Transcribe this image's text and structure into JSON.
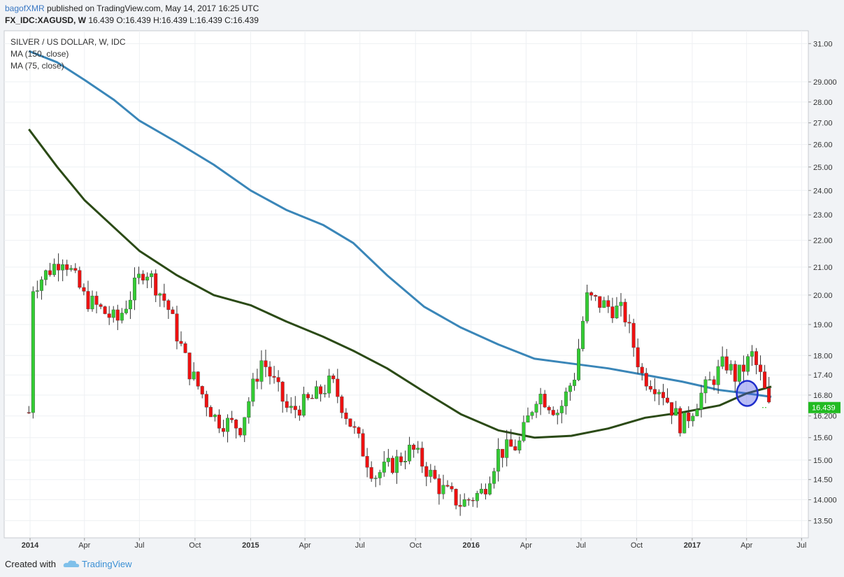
{
  "header": {
    "author": "bagofXMR",
    "published": "published on TradingView.com, May 14, 2017 16:25 UTC",
    "symbol": "FX_IDC:XAGUSD, W",
    "ohlc": "16.439 O:16.439 H:16.439 L:16.439 C:16.439"
  },
  "footer": {
    "created_with": "Created with",
    "brand": "TradingView"
  },
  "colors": {
    "up": "#33cc33",
    "down": "#ee1111",
    "ma150": "#3a86b8",
    "ma75": "#2b4a16",
    "marker": "#1f2ecc",
    "price_label": "#22bb22"
  },
  "chart_data": {
    "type": "candlestick",
    "title": "SILVER / US DOLLAR, W, IDC",
    "series": [
      {
        "name": "MA (150, close)"
      },
      {
        "name": "MA (75, close)"
      }
    ],
    "y_scale": "log",
    "ylim": [
      13.1,
      31.7
    ],
    "y_ticks": [
      "31.00",
      "29.000",
      "28.00",
      "27.00",
      "26.00",
      "25.00",
      "24.00",
      "23.00",
      "22.00",
      "21.00",
      "20.00",
      "19.00",
      "18.00",
      "17.40",
      "16.80",
      "16.200",
      "15.60",
      "15.00",
      "14.50",
      "14.000",
      "13.50"
    ],
    "x_ticks": [
      "2014",
      "Apr",
      "Jul",
      "Oct",
      "2015",
      "Apr",
      "Jul",
      "Oct",
      "2016",
      "Apr",
      "Jul",
      "Oct",
      "2017",
      "Apr",
      "Jul"
    ],
    "last_price_label": "16.439",
    "ma150_points": [
      [
        "2013-12-30",
        30.6
      ],
      [
        "2014-02-15",
        30.0
      ],
      [
        "2014-04-01",
        29.1
      ],
      [
        "2014-05-20",
        28.1
      ],
      [
        "2014-07-01",
        27.1
      ],
      [
        "2014-09-01",
        26.1
      ],
      [
        "2014-11-01",
        25.1
      ],
      [
        "2015-01-01",
        24.0
      ],
      [
        "2015-03-01",
        23.2
      ],
      [
        "2015-05-01",
        22.6
      ],
      [
        "2015-06-20",
        21.9
      ],
      [
        "2015-08-15",
        20.7
      ],
      [
        "2015-10-15",
        19.6
      ],
      [
        "2015-12-15",
        18.9
      ],
      [
        "2016-02-15",
        18.35
      ],
      [
        "2016-04-15",
        17.9
      ],
      [
        "2016-06-15",
        17.75
      ],
      [
        "2016-08-15",
        17.6
      ],
      [
        "2016-10-15",
        17.4
      ],
      [
        "2016-12-15",
        17.2
      ],
      [
        "2017-02-15",
        16.95
      ],
      [
        "2017-04-01",
        16.85
      ],
      [
        "2017-05-12",
        16.75
      ]
    ],
    "ma75_points": [
      [
        "2013-12-30",
        26.7
      ],
      [
        "2014-02-15",
        25.0
      ],
      [
        "2014-04-01",
        23.6
      ],
      [
        "2014-05-20",
        22.5
      ],
      [
        "2014-07-01",
        21.6
      ],
      [
        "2014-09-01",
        20.7
      ],
      [
        "2014-11-01",
        20.0
      ],
      [
        "2015-01-01",
        19.65
      ],
      [
        "2015-03-01",
        19.1
      ],
      [
        "2015-05-01",
        18.6
      ],
      [
        "2015-06-20",
        18.15
      ],
      [
        "2015-08-15",
        17.6
      ],
      [
        "2015-10-15",
        16.9
      ],
      [
        "2015-12-15",
        16.25
      ],
      [
        "2016-02-15",
        15.8
      ],
      [
        "2016-04-15",
        15.6
      ],
      [
        "2016-06-15",
        15.65
      ],
      [
        "2016-08-15",
        15.85
      ],
      [
        "2016-10-15",
        16.15
      ],
      [
        "2016-12-15",
        16.3
      ],
      [
        "2017-02-15",
        16.5
      ],
      [
        "2017-04-01",
        16.85
      ],
      [
        "2017-05-12",
        17.05
      ]
    ],
    "marker": {
      "date": "2017-04-02",
      "value": 16.85
    }
  }
}
